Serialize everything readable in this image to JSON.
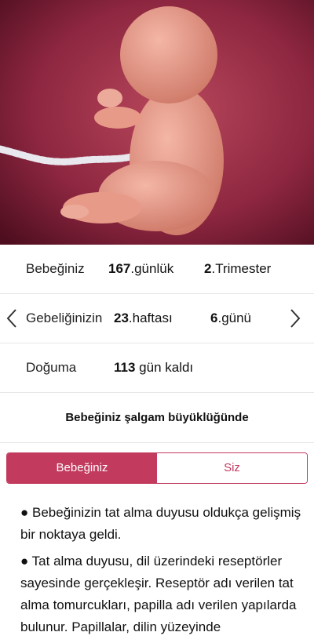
{
  "summary": {
    "baby": {
      "label": "Bebeğiniz",
      "days_value": "167",
      "days_unit": ".günlük",
      "trimester_value": "2",
      "trimester_unit": ".Trimester"
    },
    "pregnancy": {
      "label": "Gebeliğinizin",
      "week_value": "23",
      "week_unit": ".haftası",
      "day_value": "6",
      "day_unit": ".günü"
    },
    "birth": {
      "label": "Doğuma",
      "remaining_value": "113",
      "remaining_unit": " gün kaldı"
    }
  },
  "size_caption": "Bebeğiniz şalgam büyüklüğünde",
  "tabs": {
    "baby": "Bebeğiniz",
    "you": "Siz"
  },
  "content": {
    "paragraphs": [
      "● Bebeğinizin tat alma duyusu oldukça gelişmiş bir noktaya geldi.",
      "● Tat alma duyusu, dil üzerindeki reseptörler sayesinde gerçekleşir. Reseptör adı verilen tat alma tomurcukları, papilla adı verilen yapılarda bulunur. Papillalar, dilin yüzeyinde"
    ]
  },
  "colors": {
    "accent": "#c23a5e",
    "hero_bg": "#7a1e33"
  },
  "icons": {
    "prev": "chevron-left-icon",
    "next": "chevron-right-icon"
  }
}
